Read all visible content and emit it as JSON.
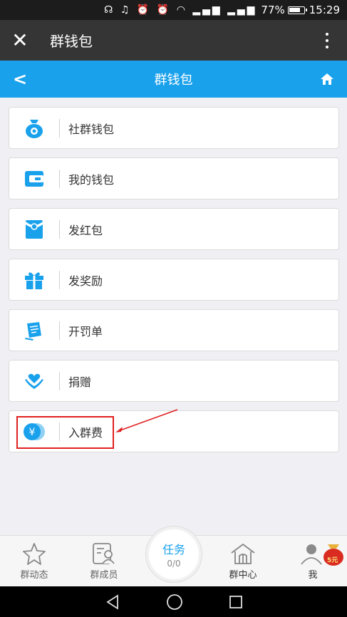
{
  "status_bar": {
    "icons": "☊ ♫ ⏰ ⏰ ◠ ▂▄▆ ▂▄▆",
    "battery_pct": "77%",
    "time": "15:29"
  },
  "wechat_header": {
    "close_icon": "✕",
    "title": "群钱包"
  },
  "page_header": {
    "back_icon": "<",
    "title": "群钱包"
  },
  "menu": [
    {
      "label": "社群钱包",
      "icon": "money-bag-icon"
    },
    {
      "label": "我的钱包",
      "icon": "wallet-icon"
    },
    {
      "label": "发红包",
      "icon": "red-envelope-icon"
    },
    {
      "label": "发奖励",
      "icon": "gift-icon"
    },
    {
      "label": "开罚单",
      "icon": "ticket-icon"
    },
    {
      "label": "捐赠",
      "icon": "heart-hand-icon"
    },
    {
      "label": "入群费",
      "icon": "yen-coin-icon"
    }
  ],
  "tabbar": {
    "items": [
      {
        "label": "群动态"
      },
      {
        "label": "群成员"
      },
      {
        "label": "群中心"
      },
      {
        "label": "我"
      }
    ],
    "task": {
      "title": "任务",
      "count": "0/0"
    },
    "badge": "5元"
  },
  "colors": {
    "accent": "#1aa1ec",
    "header_dark": "#353535",
    "highlight": "#e02020"
  }
}
